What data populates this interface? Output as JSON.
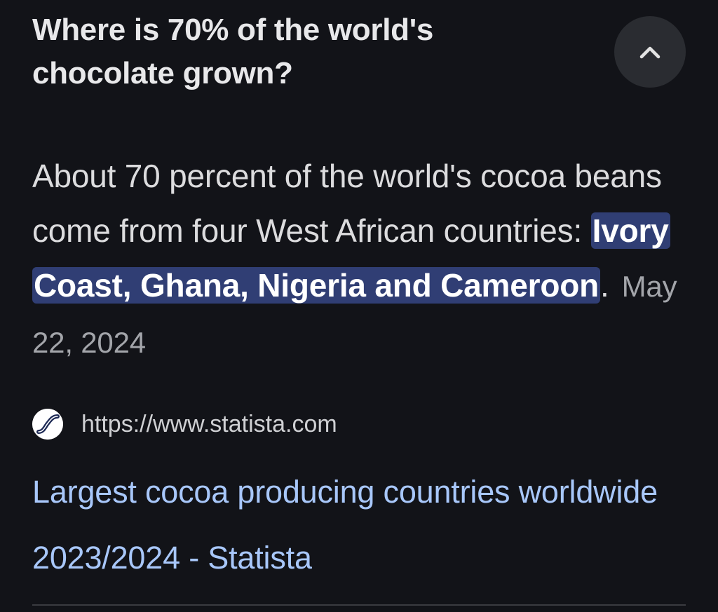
{
  "question": "Where is 70% of the world's chocolate grown?",
  "collapse_button": {
    "icon": "chevron-up-icon"
  },
  "answer": {
    "prefix": "About 70 percent of the world's cocoa beans come from four West African countries: ",
    "highlight": "Ivory Coast, Ghana, Nigeria and Cameroon",
    "suffix": ".",
    "date": "May 22, 2024"
  },
  "source": {
    "favicon": "statista-icon",
    "url": "https://www.statista.com"
  },
  "result": {
    "title": "Largest cocoa producing countries worldwide 2023/2024 - Statista"
  },
  "colors": {
    "background": "#121318",
    "highlight_bg": "#303e74",
    "link": "#a8c7fa",
    "button_bg": "#2a2c31"
  }
}
